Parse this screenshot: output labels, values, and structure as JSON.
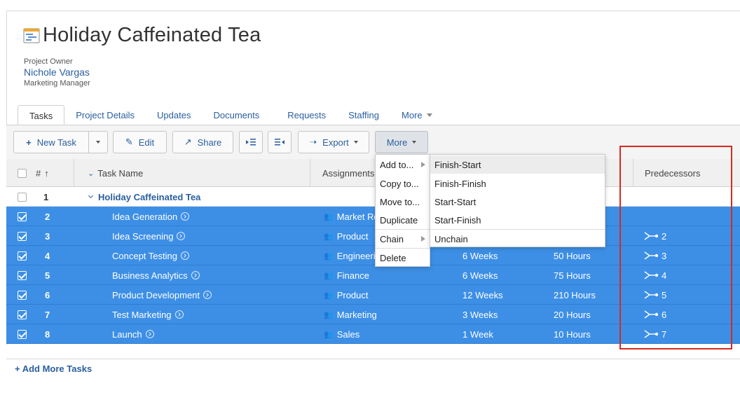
{
  "project": {
    "title": "Holiday Caffeinated Tea",
    "owner_label": "Project Owner",
    "owner_name": "Nichole Vargas",
    "owner_role": "Marketing Manager"
  },
  "tabs": [
    {
      "label": "Tasks",
      "active": true
    },
    {
      "label": "Project Details"
    },
    {
      "label": "Updates"
    },
    {
      "label": "Documents"
    },
    {
      "label": "Requests"
    },
    {
      "label": "Staffing"
    },
    {
      "label": "More"
    }
  ],
  "toolbar": {
    "new_task": "New Task",
    "edit": "Edit",
    "share": "Share",
    "export": "Export",
    "more": "More"
  },
  "grid": {
    "columns": {
      "number": "#",
      "task_name": "Task Name",
      "assignments": "Assignments",
      "predecessors": "Predecessors"
    },
    "rows": [
      {
        "num": "1",
        "name": "Holiday Caffeinated Tea",
        "assignment": "",
        "duration": "",
        "planned": "",
        "predecessor": "",
        "selected": false
      },
      {
        "num": "2",
        "name": "Idea Generation",
        "assignment": "Market Re",
        "duration": "",
        "planned": "",
        "predecessor": "",
        "selected": true
      },
      {
        "num": "3",
        "name": "Idea Screening",
        "assignment": "Product",
        "duration": "",
        "planned": "",
        "predecessor": "2",
        "selected": true
      },
      {
        "num": "4",
        "name": "Concept Testing",
        "assignment": "Engineeri",
        "duration": "6 Weeks",
        "planned": "50 Hours",
        "predecessor": "3",
        "selected": true
      },
      {
        "num": "5",
        "name": "Business Analytics",
        "assignment": "Finance",
        "duration": "6 Weeks",
        "planned": "75 Hours",
        "predecessor": "4",
        "selected": true
      },
      {
        "num": "6",
        "name": "Product Development",
        "assignment": "Product",
        "duration": "12 Weeks",
        "planned": "210 Hours",
        "predecessor": "5",
        "selected": true
      },
      {
        "num": "7",
        "name": "Test Marketing",
        "assignment": "Marketing",
        "duration": "3 Weeks",
        "planned": "20 Hours",
        "predecessor": "6",
        "selected": true
      },
      {
        "num": "8",
        "name": "Launch",
        "assignment": "Sales",
        "duration": "1 Week",
        "planned": "10 Hours",
        "predecessor": "7",
        "selected": true
      }
    ]
  },
  "more_menu": {
    "items": [
      "Add to...",
      "Copy to...",
      "Move to...",
      "Duplicate",
      "Chain",
      "Delete"
    ]
  },
  "chain_submenu": {
    "items": [
      "Finish-Start",
      "Finish-Finish",
      "Start-Start",
      "Start-Finish",
      "Unchain"
    ]
  },
  "footer": {
    "add_more": "+ Add More Tasks"
  },
  "colors": {
    "selected_row": "#3d8fe6",
    "link": "#2a5f9e",
    "highlight_box": "#d42b1e"
  }
}
